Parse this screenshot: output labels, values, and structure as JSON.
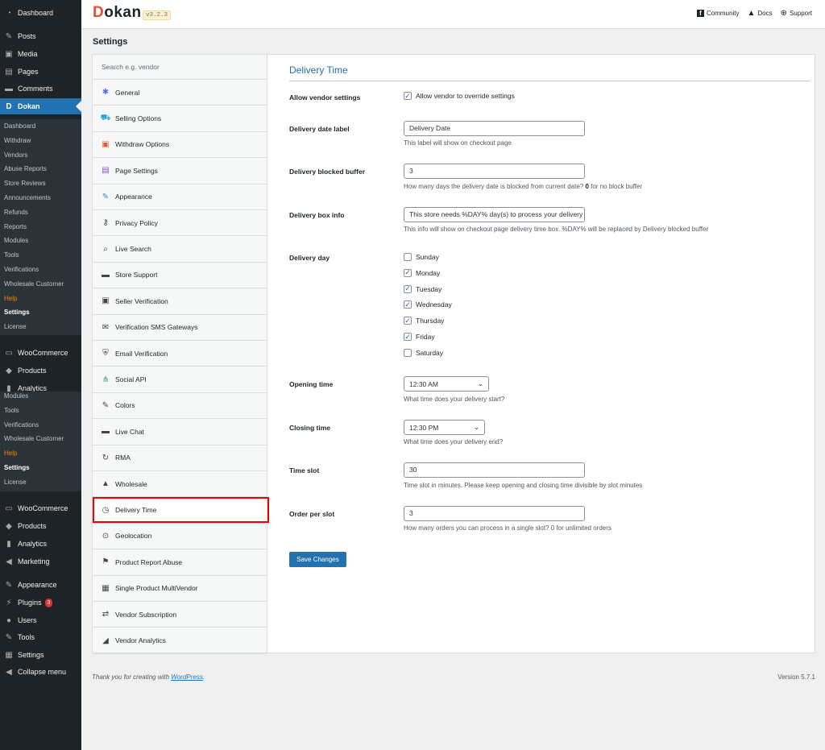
{
  "admin_menu": {
    "top": [
      {
        "label": "Dashboard",
        "icon": "dashboard-icon"
      },
      {
        "label": "Posts",
        "icon": "pin-icon"
      },
      {
        "label": "Media",
        "icon": "media-icon"
      },
      {
        "label": "Pages",
        "icon": "pages-icon"
      },
      {
        "label": "Comments",
        "icon": "comments-icon"
      },
      {
        "label": "Dokan",
        "icon": "dokan-icon"
      }
    ],
    "dokan_sub": [
      "Dashboard",
      "Withdraw",
      "Vendors",
      "Abuse Reports",
      "Store Reviews",
      "Announcements",
      "Refunds",
      "Reports",
      "Modules",
      "Tools",
      "Verifications",
      "Wholesale Customer",
      "Help",
      "Settings",
      "License"
    ],
    "mid": [
      {
        "label": "WooCommerce",
        "icon": "woocommerce-icon"
      },
      {
        "label": "Products",
        "icon": "products-icon"
      },
      {
        "label": "Analytics",
        "icon": "analytics-icon"
      }
    ],
    "dup_sub": [
      "Modules",
      "Tools",
      "Verifications",
      "Wholesale Customer",
      "Help",
      "Settings",
      "License"
    ],
    "bottom": [
      {
        "label": "WooCommerce",
        "icon": "woocommerce-icon"
      },
      {
        "label": "Products",
        "icon": "products-icon"
      },
      {
        "label": "Analytics",
        "icon": "analytics-icon"
      },
      {
        "label": "Marketing",
        "icon": "megaphone-icon"
      },
      {
        "label": "Appearance",
        "icon": "brush-icon"
      },
      {
        "label": "Plugins",
        "icon": "plugin-icon",
        "badge": "3"
      },
      {
        "label": "Users",
        "icon": "users-icon"
      },
      {
        "label": "Tools",
        "icon": "wrench-icon"
      },
      {
        "label": "Settings",
        "icon": "settings-icon"
      },
      {
        "label": "Collapse menu",
        "icon": "collapse-icon"
      }
    ]
  },
  "header": {
    "logo": "okan",
    "logo_d": "D",
    "version": "v3.2.3",
    "links": [
      {
        "label": "Community",
        "icon": "facebook-icon"
      },
      {
        "label": "Docs",
        "icon": "graduation-cap-icon"
      },
      {
        "label": "Support",
        "icon": "lifebuoy-icon"
      }
    ]
  },
  "page_title": "Settings",
  "settings_nav": {
    "search_placeholder": "Search e.g. vendor",
    "items": [
      {
        "label": "General",
        "icon": "gear-icon",
        "color": "#5b6ee1"
      },
      {
        "label": "Selling Options",
        "icon": "cart-icon",
        "color": "#2aa0d8"
      },
      {
        "label": "Withdraw Options",
        "icon": "withdraw-icon",
        "color": "#e5573b"
      },
      {
        "label": "Page Settings",
        "icon": "page-icon",
        "color": "#8b4fd1"
      },
      {
        "label": "Appearance",
        "icon": "brush-icon",
        "color": "#2e88c8"
      },
      {
        "label": "Privacy Policy",
        "icon": "key-icon",
        "color": "#444"
      },
      {
        "label": "Live Search",
        "icon": "search-icon",
        "color": "#444"
      },
      {
        "label": "Store Support",
        "icon": "chat-icon",
        "color": "#444"
      },
      {
        "label": "Seller Verification",
        "icon": "lock-icon",
        "color": "#444"
      },
      {
        "label": "Verification SMS Gateways",
        "icon": "envelope-icon",
        "color": "#444"
      },
      {
        "label": "Email Verification",
        "icon": "shield-icon",
        "color": "#444"
      },
      {
        "label": "Social API",
        "icon": "network-icon",
        "color": "#2aa07a"
      },
      {
        "label": "Colors",
        "icon": "brush-icon",
        "color": "#444"
      },
      {
        "label": "Live Chat",
        "icon": "chat-icon",
        "color": "#444"
      },
      {
        "label": "RMA",
        "icon": "return-icon",
        "color": "#444"
      },
      {
        "label": "Wholesale",
        "icon": "boxes-icon",
        "color": "#444"
      },
      {
        "label": "Delivery Time",
        "icon": "clock-icon",
        "color": "#444"
      },
      {
        "label": "Geolocation",
        "icon": "location-icon",
        "color": "#444"
      },
      {
        "label": "Product Report Abuse",
        "icon": "flag-icon",
        "color": "#444"
      },
      {
        "label": "Single Product MultiVendor",
        "icon": "store-icon",
        "color": "#444"
      },
      {
        "label": "Vendor Subscription",
        "icon": "repeat-icon",
        "color": "#444"
      },
      {
        "label": "Vendor Analytics",
        "icon": "chart-icon",
        "color": "#444"
      }
    ],
    "active": "Delivery Time"
  },
  "form": {
    "section_title": "Delivery Time",
    "allow_vendor": {
      "label": "Allow vendor settings",
      "checkbox_label": "Allow vendor to override settings",
      "checked": true
    },
    "date_label": {
      "label": "Delivery date label",
      "value": "Delivery Date",
      "desc": "This label will show on checkout page"
    },
    "blocked_buffer": {
      "label": "Delivery blocked buffer",
      "value": "3",
      "desc_a": "How many days the delivery date is blocked from current date?",
      "desc_b": "0",
      "desc_c": "for no block buffer"
    },
    "box_info": {
      "label": "Delivery box info",
      "value": "This store needs %DAY% day(s) to process your delivery request",
      "desc": "This info will show on checkout page delivery time box. %DAY% will be replaced by Delivery blocked buffer"
    },
    "delivery_day": {
      "label": "Delivery day",
      "days": [
        {
          "name": "Sunday",
          "checked": false
        },
        {
          "name": "Monday",
          "checked": true
        },
        {
          "name": "Tuesday",
          "checked": true
        },
        {
          "name": "Wednesday",
          "checked": true
        },
        {
          "name": "Thursday",
          "checked": true
        },
        {
          "name": "Friday",
          "checked": true
        },
        {
          "name": "Saturday",
          "checked": false
        }
      ]
    },
    "opening_time": {
      "label": "Opening time",
      "value": "12:30 AM",
      "desc": "What time does your delivery start?"
    },
    "closing_time": {
      "label": "Closing time",
      "value": "12:30 PM",
      "desc": "What time does your delivery end?"
    },
    "time_slot": {
      "label": "Time slot",
      "value": "30",
      "desc": "Time slot in minutes. Please keep opening and closing time divisible by slot minutes"
    },
    "order_per_slot": {
      "label": "Order per slot",
      "value": "3",
      "desc": "How many orders you can process in a single slot? 0 for unlimited orders"
    },
    "save_label": "Save Changes"
  },
  "footer": {
    "thanks": "Thank you for creating with ",
    "link": "WordPress",
    "period": ".",
    "version": "Version 5.7.1"
  },
  "colors": {
    "accent": "#2271b1",
    "menu_bg": "#1d2327",
    "highlight_border": "#e00000"
  }
}
